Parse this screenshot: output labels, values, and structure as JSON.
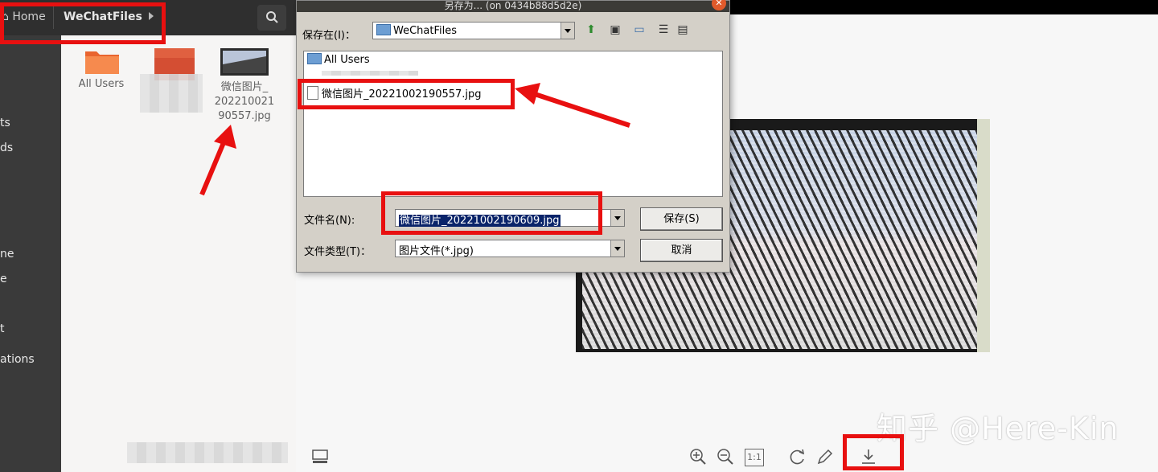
{
  "file_manager": {
    "breadcrumb": {
      "home": "Home",
      "current": "WeChatFiles"
    },
    "sidebar_items": [
      "ts",
      "ds",
      "ne",
      "e",
      "t",
      "ations"
    ],
    "files": [
      {
        "label": "All Users",
        "type": "folder"
      },
      {
        "label": "",
        "type": "blurred-folder"
      },
      {
        "label": "微信图片_\n202210021\n90557.jpg",
        "type": "image"
      }
    ]
  },
  "dialog": {
    "title": "另存为... (on 0434b88d5d2e)",
    "save_in_label": "保存在(I)：",
    "save_in_value": "WeChatFiles",
    "list_items": [
      "All Users",
      "微信图片_20221002190557.jpg"
    ],
    "filename_label": "文件名(N):",
    "filename_value": "微信图片_20221002190609.jpg",
    "filetype_label": "文件类型(T)：",
    "filetype_value": "图片文件(*.jpg)",
    "save_button": "保存(S)",
    "cancel_button": "取消"
  },
  "viewer": {
    "zoom_reset_label": "1:1",
    "watermark": "知乎 @Here-Kin"
  },
  "colors": {
    "annotation_red": "#e81010",
    "selection_blue": "#0a246a"
  }
}
